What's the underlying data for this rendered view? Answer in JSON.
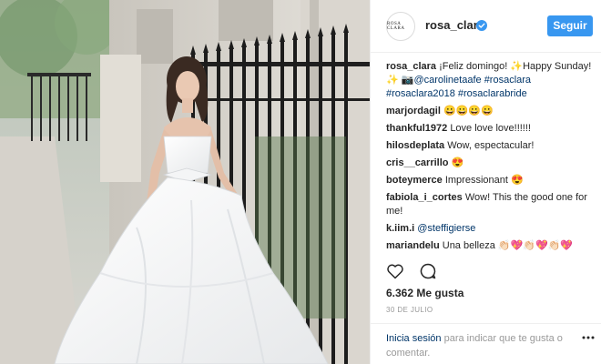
{
  "post": {
    "username": "rosa_clara",
    "avatar_text": "ROSA CLARA",
    "follow_label": "Seguir",
    "caption": {
      "author": "rosa_clara",
      "text_1": "¡Feliz domingo! ",
      "emoji_1": "✨",
      "text_2": "Happy Sunday! ",
      "emoji_2": "✨",
      "camera": "📷",
      "mention": "@carolinetaafe",
      "tags": "#rosaclara #rosaclara2018 #rosaclarabride"
    },
    "comments": [
      {
        "author": "marjordagil",
        "text": "😀😀😀😀"
      },
      {
        "author": "thankful1972",
        "text": "Love love love!!!!!!"
      },
      {
        "author": "hilosdeplata",
        "text": "Wow, espectacular!"
      },
      {
        "author": "cris__carrillo",
        "text": "😍"
      },
      {
        "author": "boteymerce",
        "text": "Impressionant 😍"
      },
      {
        "author": "fabiola_i_cortes",
        "text": "Wow! This the good one for me!"
      },
      {
        "author": "k.iim.i",
        "text": "@steffigierse"
      },
      {
        "author": "mariandelu",
        "text": "Una belleza 👏🏻💖👏🏻💖👏🏻💖"
      }
    ],
    "likes": "6.362 Me gusta",
    "date": "30 DE JULIO",
    "footer": {
      "login_label": "Inicia sesión",
      "rest": " para indicar que te gusta o comentar."
    },
    "icons": {
      "verified": "verified-badge-icon",
      "like": "heart-outline-icon",
      "comment": "comment-bubble-icon",
      "more": "more-dots-icon"
    },
    "colors": {
      "accent": "#3897f0",
      "link": "#003569",
      "muted": "#999999",
      "text": "#262626"
    }
  }
}
